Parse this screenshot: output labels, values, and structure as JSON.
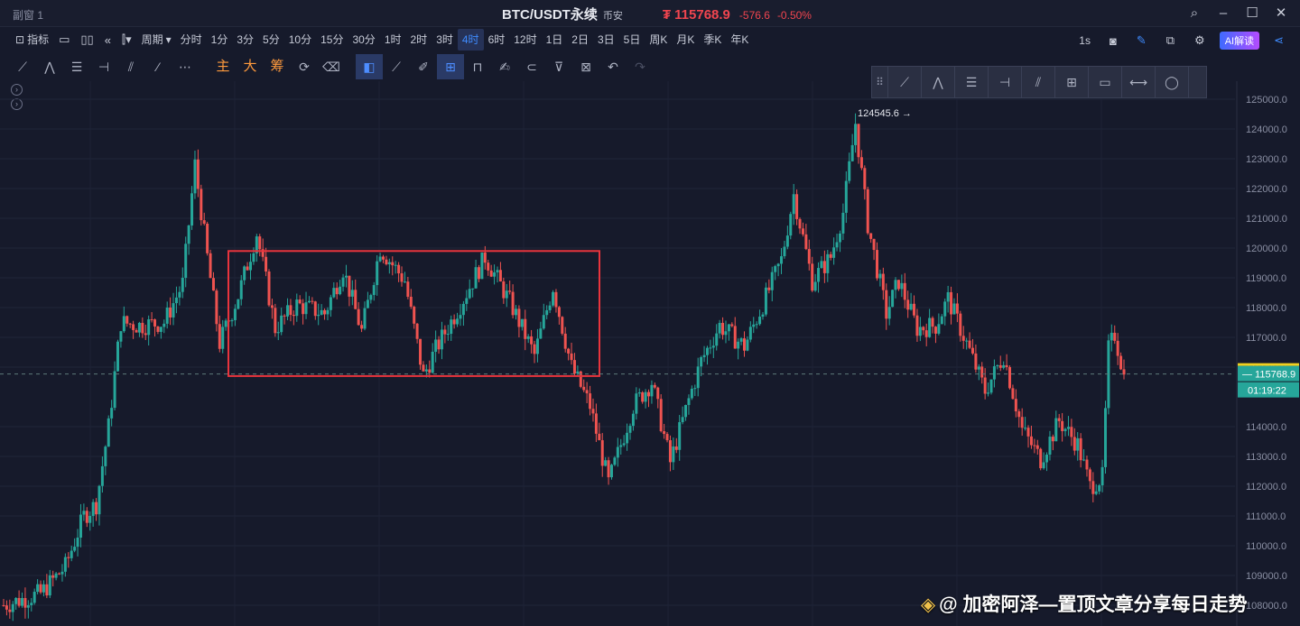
{
  "window": {
    "label": "副窗 1"
  },
  "title": {
    "symbol": "BTC/USDT永续",
    "exchange": "币安",
    "price": "₮ 115768.9",
    "change": "-576.6",
    "change_pct": "-0.50%"
  },
  "toolbar": {
    "indicator_label": "指标",
    "period_label": "周期",
    "timeframes": [
      "分时",
      "1分",
      "3分",
      "5分",
      "10分",
      "15分",
      "30分",
      "1时",
      "2时",
      "3时",
      "4时",
      "6时",
      "12时",
      "1日",
      "2日",
      "3日",
      "5日",
      "周K",
      "月K",
      "季K",
      "年K"
    ],
    "active_timeframe": "4时",
    "interval_readout": "1s",
    "ai_label": "AI解读"
  },
  "draw_toolbar": {
    "main_label": "主",
    "big_label": "大",
    "chip_label": "筹"
  },
  "colors": {
    "up": "#26a69a",
    "down": "#ef5350",
    "background": "#161a2b",
    "accent": "#3f8cff",
    "box": "#e8343d"
  },
  "chart_data": {
    "type": "candlestick",
    "title": "",
    "xlabel": "",
    "ylabel": "",
    "ylim": [
      108000,
      125500
    ],
    "y_ticks": [
      125000,
      124000,
      123000,
      122000,
      121000,
      120000,
      119000,
      118000,
      117000,
      116000,
      114000,
      113000,
      112000,
      111000,
      110000,
      109000,
      108000
    ],
    "y_tick_labels": [
      "125000.0",
      "124000.0",
      "123000.0",
      "122000.0",
      "121000.0",
      "120000.0",
      "119000.0",
      "118000.0",
      "117000.0",
      "116000.0",
      "114000.0",
      "113000.0",
      "112000.0",
      "111000.0",
      "110000.0",
      "109000.0",
      "108000.0"
    ],
    "current_price": 115768.9,
    "current_price_label": "115768.9",
    "countdown_label": "01:19:22",
    "high_annotation": {
      "value": 124545.6,
      "label": "124545.6"
    },
    "range_box": {
      "top": 119900,
      "bottom": 115700
    },
    "anchors": [
      {
        "i": 0,
        "p": 108000
      },
      {
        "i": 12,
        "p": 108400
      },
      {
        "i": 20,
        "p": 109300
      },
      {
        "i": 26,
        "p": 111000
      },
      {
        "i": 30,
        "p": 111400
      },
      {
        "i": 34,
        "p": 114000
      },
      {
        "i": 38,
        "p": 117500
      },
      {
        "i": 44,
        "p": 117400
      },
      {
        "i": 52,
        "p": 117500
      },
      {
        "i": 58,
        "p": 118800
      },
      {
        "i": 62,
        "p": 122800
      },
      {
        "i": 66,
        "p": 119700
      },
      {
        "i": 70,
        "p": 116800
      },
      {
        "i": 76,
        "p": 118400
      },
      {
        "i": 82,
        "p": 120500
      },
      {
        "i": 88,
        "p": 117300
      },
      {
        "i": 95,
        "p": 118100
      },
      {
        "i": 104,
        "p": 117800
      },
      {
        "i": 110,
        "p": 119300
      },
      {
        "i": 116,
        "p": 117200
      },
      {
        "i": 122,
        "p": 120000
      },
      {
        "i": 130,
        "p": 118900
      },
      {
        "i": 136,
        "p": 115700
      },
      {
        "i": 140,
        "p": 116600
      },
      {
        "i": 148,
        "p": 118100
      },
      {
        "i": 156,
        "p": 119700
      },
      {
        "i": 164,
        "p": 118200
      },
      {
        "i": 172,
        "p": 116400
      },
      {
        "i": 178,
        "p": 118700
      },
      {
        "i": 184,
        "p": 116000
      },
      {
        "i": 190,
        "p": 114700
      },
      {
        "i": 196,
        "p": 112100
      },
      {
        "i": 204,
        "p": 114700
      },
      {
        "i": 210,
        "p": 115500
      },
      {
        "i": 216,
        "p": 112800
      },
      {
        "i": 222,
        "p": 114900
      },
      {
        "i": 226,
        "p": 116200
      },
      {
        "i": 232,
        "p": 117400
      },
      {
        "i": 240,
        "p": 116700
      },
      {
        "i": 246,
        "p": 118100
      },
      {
        "i": 252,
        "p": 119600
      },
      {
        "i": 256,
        "p": 121800
      },
      {
        "i": 262,
        "p": 118900
      },
      {
        "i": 268,
        "p": 119700
      },
      {
        "i": 272,
        "p": 121200
      },
      {
        "i": 276,
        "p": 124200
      },
      {
        "i": 280,
        "p": 120800
      },
      {
        "i": 286,
        "p": 117800
      },
      {
        "i": 290,
        "p": 118900
      },
      {
        "i": 296,
        "p": 117300
      },
      {
        "i": 302,
        "p": 117400
      },
      {
        "i": 306,
        "p": 118300
      },
      {
        "i": 312,
        "p": 116800
      },
      {
        "i": 318,
        "p": 115200
      },
      {
        "i": 324,
        "p": 116400
      },
      {
        "i": 330,
        "p": 113900
      },
      {
        "i": 336,
        "p": 112900
      },
      {
        "i": 342,
        "p": 114200
      },
      {
        "i": 348,
        "p": 113400
      },
      {
        "i": 352,
        "p": 112000
      },
      {
        "i": 356,
        "p": 112300
      },
      {
        "i": 358,
        "p": 116600
      },
      {
        "i": 360,
        "p": 117100
      },
      {
        "i": 363,
        "p": 115750
      }
    ]
  },
  "palette": {
    "grip": "⠿"
  },
  "watermark": {
    "text": "@ 加密阿泽—置顶文章分享每日走势"
  }
}
